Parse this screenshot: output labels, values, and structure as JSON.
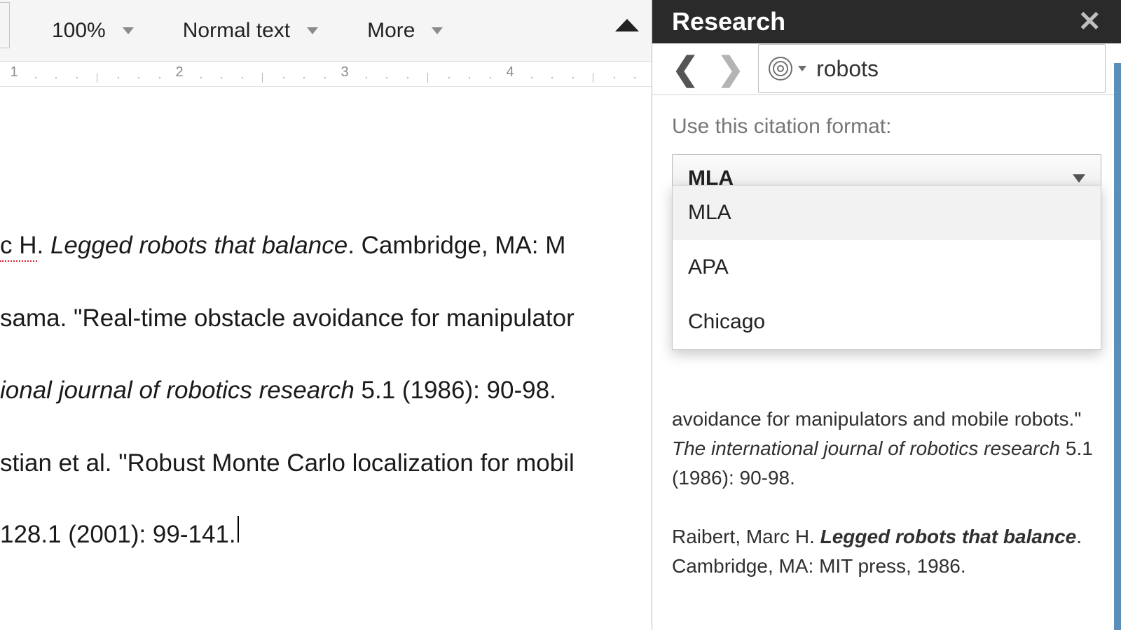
{
  "toolbar": {
    "zoom": "100%",
    "style": "Normal text",
    "more": "More"
  },
  "ruler": {
    "nums": [
      "1",
      "2",
      "3",
      "4"
    ]
  },
  "doc": {
    "lines": [
      {
        "segs": [
          {
            "t": "c H",
            "cls": "spellerr"
          },
          {
            "t": ". "
          },
          {
            "t": "Legged robots that balance",
            "cls": "ital"
          },
          {
            "t": ". Cambridge, MA: M"
          }
        ]
      },
      {
        "segs": [
          {
            "t": "sama. \"Real-time obstacle avoidance for manipulator"
          }
        ]
      },
      {
        "segs": [
          {
            "t": "ional journal of robotics research",
            "cls": "ital"
          },
          {
            "t": " 5.1 (1986): 90-98."
          }
        ]
      },
      {
        "segs": [
          {
            "t": "stian et al. \"Robust Monte Carlo localization for mobil"
          }
        ]
      },
      {
        "segs": [
          {
            "t": " 128.1 (2001): 99-141."
          },
          {
            "t": "",
            "cls": "cursor"
          }
        ]
      }
    ]
  },
  "sidebar": {
    "title": "Research",
    "search": "robots",
    "hint": "Use this citation format:",
    "selected": "MLA",
    "options": [
      "MLA",
      "APA",
      "Chicago"
    ],
    "results": [
      [
        {
          "t": "avoidance for manipulators and mobile robots.\" "
        },
        {
          "t": "The international journal of robotics research",
          "cls": "ital"
        },
        {
          "t": " 5.1 (1986): 90-98."
        }
      ],
      [
        {
          "t": "Raibert, Marc H. "
        },
        {
          "t": "Legged robots that balance",
          "cls": "bold-it"
        },
        {
          "t": ". Cambridge, MA: MIT press, 1986."
        }
      ]
    ]
  }
}
